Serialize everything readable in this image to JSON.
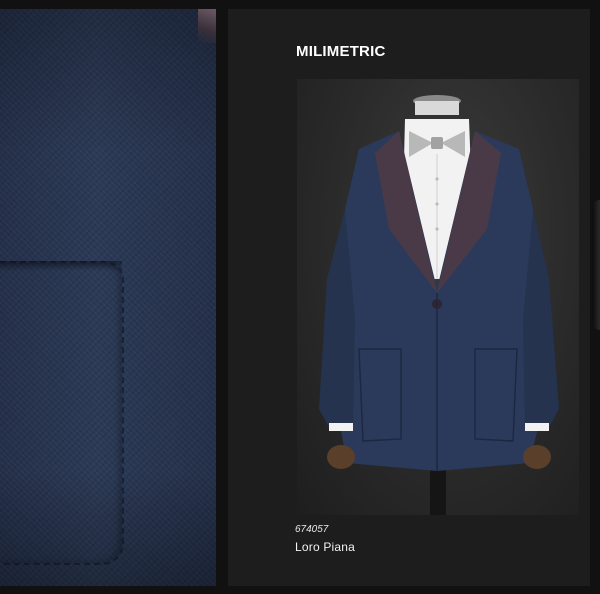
{
  "card": {
    "brand": "MILIMETRIC",
    "sku": "674057",
    "fabric_name": "Loro Piana"
  },
  "colors": {
    "background": "#111111",
    "card": "#1d1d1d",
    "suit_navy": "#2b3a5a",
    "lapel_satin": "#4a3a48",
    "shirt": "#f2f2f2",
    "bow_tie": "#b8b8b8"
  },
  "images": {
    "left_panel": "navy-fabric-closeup-with-patch-pocket",
    "product_photo": "navy-tuxedo-jacket-on-mannequin-with-grey-bow-tie"
  }
}
